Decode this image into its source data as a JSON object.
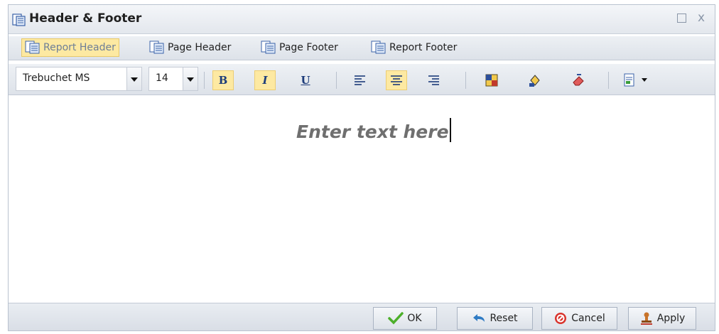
{
  "dialog": {
    "title": "Header & Footer",
    "window_buttons": {
      "maximize": "□",
      "close": "x"
    }
  },
  "tabs": [
    {
      "label": "Report Header",
      "active": true
    },
    {
      "label": "Page Header",
      "active": false
    },
    {
      "label": "Page Footer",
      "active": false
    },
    {
      "label": "Report Footer",
      "active": false
    }
  ],
  "toolbar": {
    "font_family": "Trebuchet MS",
    "font_size": "14",
    "bold": "B",
    "italic": "I",
    "underline": "U",
    "align_center_active": true,
    "bold_active": true,
    "italic_active": true
  },
  "editor": {
    "text": "Enter text here"
  },
  "footer": {
    "ok": "OK",
    "reset": "Reset",
    "cancel": "Cancel",
    "apply": "Apply"
  },
  "colors": {
    "active_tab": "#fde9a2",
    "toolbar_bg": "#dde2e9",
    "editor_text": "#6f6f6f"
  }
}
